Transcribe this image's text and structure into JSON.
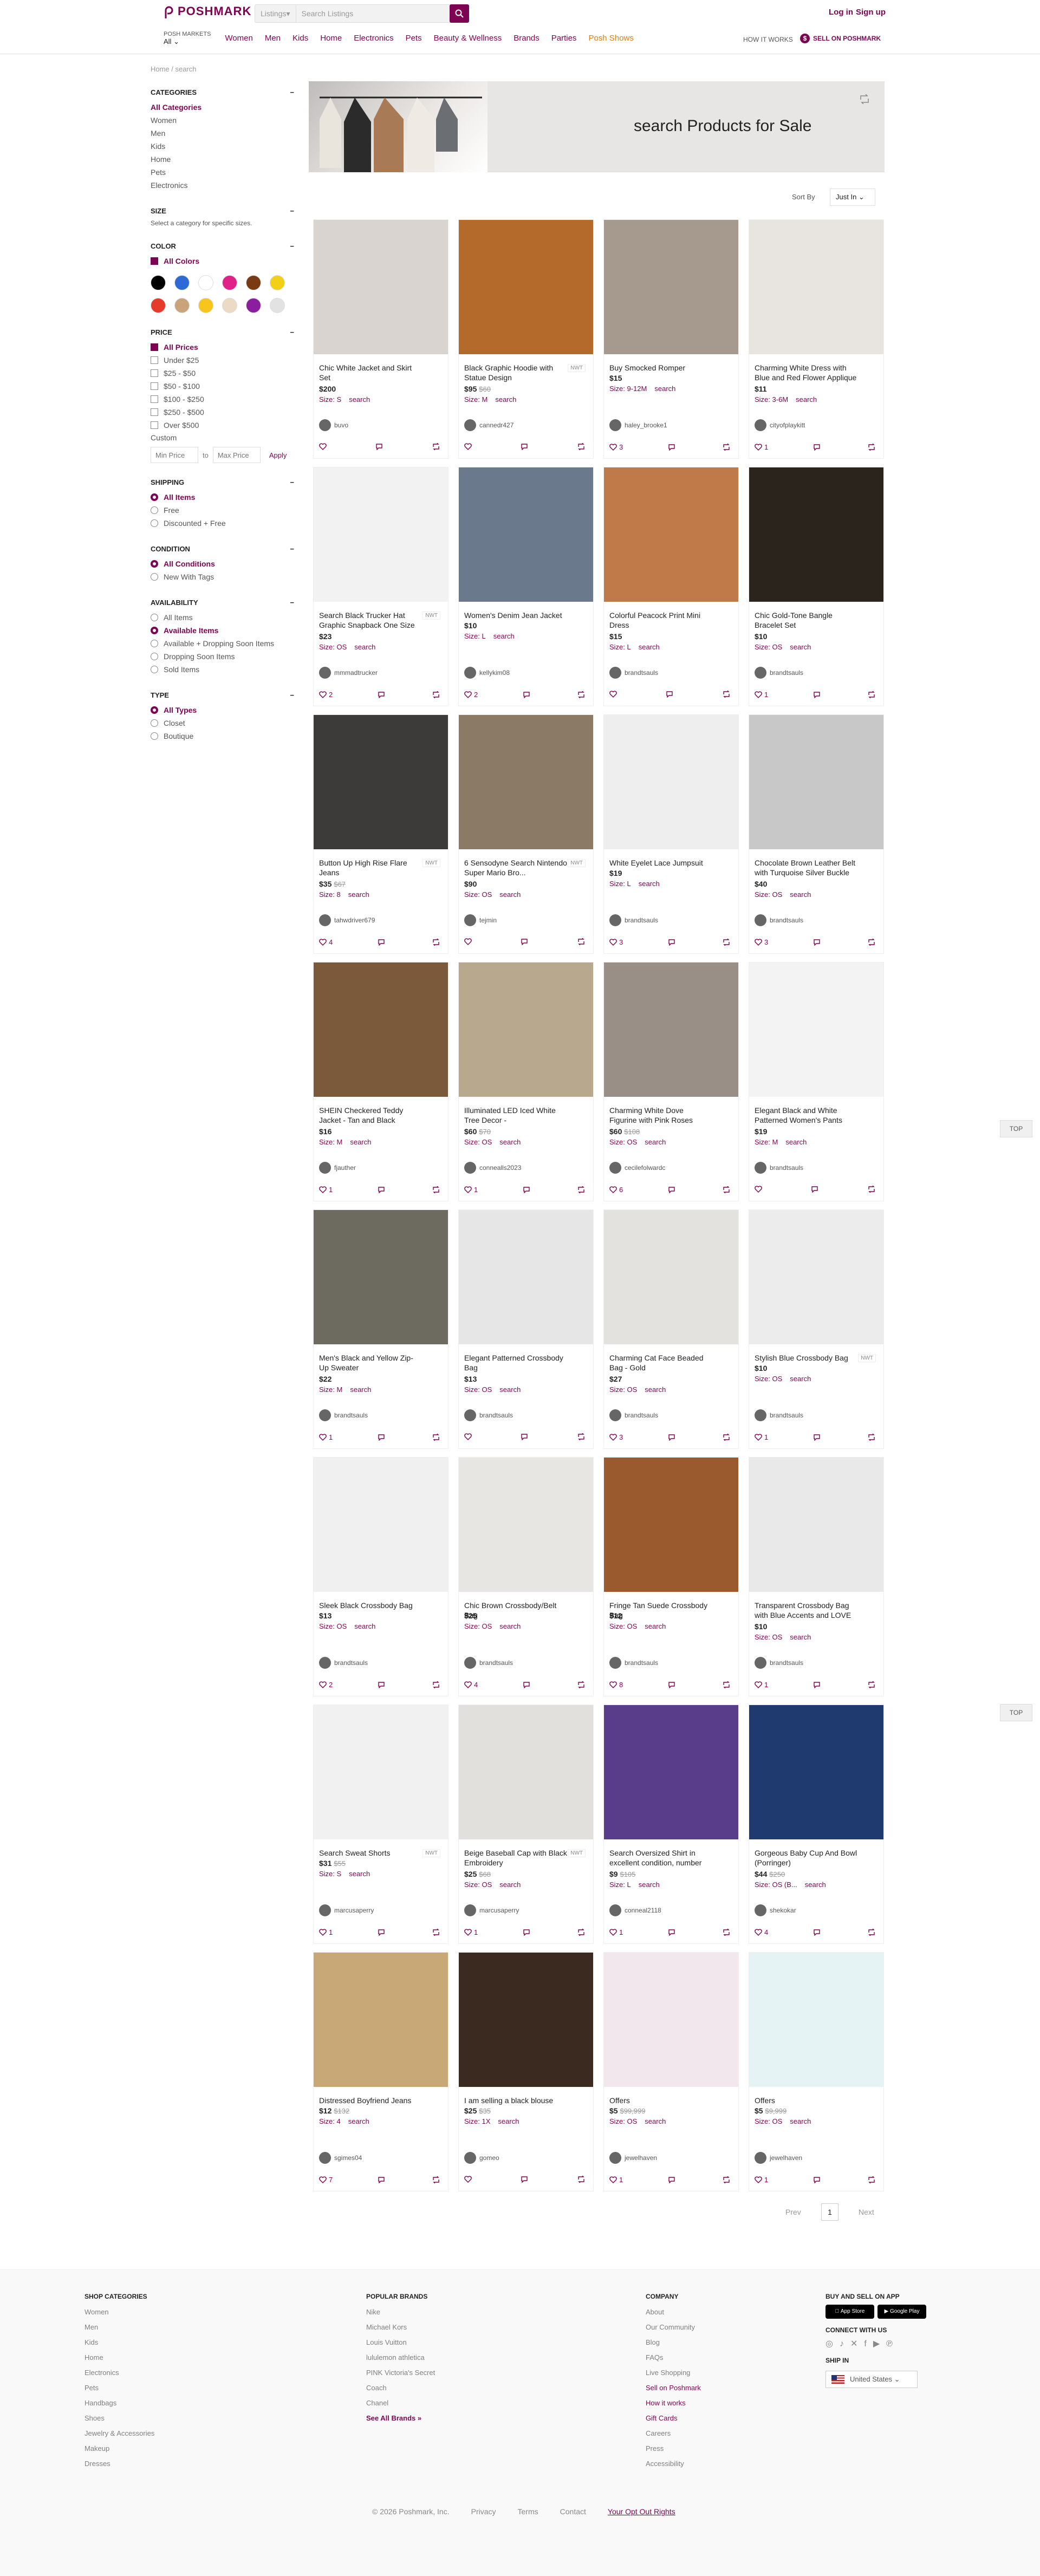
{
  "header": {
    "logo": "POSHMARK",
    "search_scope": "Listings",
    "search_placeholder": "Search Listings",
    "login": "Log in",
    "signup": "Sign up",
    "market_label": "POSH MARKETS",
    "market_value": "All",
    "nav": [
      "Women",
      "Men",
      "Kids",
      "Home",
      "Electronics",
      "Pets",
      "Beauty & Wellness",
      "Brands",
      "Parties",
      "Posh Shows"
    ],
    "how_it_works": "HOW IT WORKS",
    "sell": "SELL ON POSHMARK"
  },
  "sidebar": {
    "breadcrumb": "Home  /  search",
    "categories": {
      "title": "CATEGORIES",
      "items": [
        "All Categories",
        "Women",
        "Men",
        "Kids",
        "Home",
        "Pets",
        "Electronics"
      ]
    },
    "size": {
      "title": "SIZE",
      "note": "Select a category for specific sizes."
    },
    "color": {
      "title": "COLOR",
      "all": "All Colors",
      "swatches": [
        "#000000",
        "#2d6ad6",
        "#ffffff",
        "#e0218a",
        "#7a3b12",
        "#f2d017",
        "#e53b2c",
        "#c9a37a",
        "#f7c51b",
        "#ecd9c6",
        "#8a1e9e",
        "#e2e2e2"
      ]
    },
    "price": {
      "title": "PRICE",
      "items": [
        "All Prices",
        "Under $25",
        "$25 - $50",
        "$50 - $100",
        "$100 - $250",
        "$250 - $500",
        "Over $500"
      ],
      "custom": "Custom",
      "min": "Min Price",
      "to": "to",
      "max": "Max Price",
      "apply": "Apply"
    },
    "shipping": {
      "title": "SHIPPING",
      "items": [
        "All Items",
        "Free",
        "Discounted + Free"
      ]
    },
    "condition": {
      "title": "CONDITION",
      "items": [
        "All Conditions",
        "New With Tags"
      ]
    },
    "availability": {
      "title": "AVAILABILITY",
      "items": [
        "All Items",
        "Available Items",
        "Available + Dropping Soon Items",
        "Dropping Soon Items",
        "Sold Items"
      ]
    },
    "type": {
      "title": "TYPE",
      "items": [
        "All Types",
        "Closet",
        "Boutique"
      ]
    }
  },
  "banner": {
    "title": "search Products for Sale"
  },
  "sort": {
    "label": "Sort By",
    "value": "Just In"
  },
  "products": [
    {
      "title": "Chic White Jacket and Skirt Set",
      "price": "$200",
      "orig": "",
      "size": "Size: S",
      "tag": "search",
      "user": "buvo",
      "likes": "",
      "nwt": "",
      "img": "#d9d4cf"
    },
    {
      "title": "Black Graphic Hoodie with Statue Design",
      "price": "$95",
      "orig": "$60",
      "size": "Size: M",
      "tag": "search",
      "user": "cannedr427",
      "likes": "",
      "nwt": "NWT",
      "img": "#b36a2a"
    },
    {
      "title": "Buy Smocked Romper",
      "price": "$15",
      "orig": "",
      "size": "Size: 9-12M",
      "tag": "search",
      "user": "haley_brooke1",
      "likes": "3",
      "nwt": "",
      "img": "#a59a8d"
    },
    {
      "title": "Charming White Dress with Blue and Red Flower Applique",
      "price": "$11",
      "orig": "",
      "size": "Size: 3-6M",
      "tag": "search",
      "user": "cityofplaykitt",
      "likes": "1",
      "nwt": "",
      "img": "#e8e4df"
    },
    {
      "title": "Search Black Trucker Hat Graphic Snapback One Size",
      "price": "$23",
      "orig": "",
      "size": "Size: OS",
      "tag": "search",
      "user": "mmmadtrucker",
      "likes": "2",
      "nwt": "NWT",
      "img": "#f2f2f2"
    },
    {
      "title": "Women's Denim Jean Jacket",
      "price": "$10",
      "orig": "",
      "size": "Size: L",
      "tag": "search",
      "user": "kellykim08",
      "likes": "2",
      "nwt": "",
      "img": "#6a7a8c"
    },
    {
      "title": "Colorful Peacock Print Mini Dress",
      "price": "$15",
      "orig": "",
      "size": "Size: L",
      "tag": "search",
      "user": "brandtsauls",
      "likes": "",
      "nwt": "",
      "img": "#c07a4a"
    },
    {
      "title": "Chic Gold-Tone Bangle Bracelet Set",
      "price": "$10",
      "orig": "",
      "size": "Size: OS",
      "tag": "search",
      "user": "brandtsauls",
      "likes": "1",
      "nwt": "",
      "img": "#2a241c"
    },
    {
      "title": "Button Up High Rise Flare Jeans",
      "price": "$35",
      "orig": "$67",
      "size": "Size: 8",
      "tag": "search",
      "user": "tahwdriver679",
      "likes": "4",
      "nwt": "NWT",
      "img": "#3d3b3a"
    },
    {
      "title": "6 Sensodyne Search Nintendo Super Mario Bro...",
      "price": "$90",
      "orig": "",
      "size": "Size: OS",
      "tag": "search",
      "user": "tejmin",
      "likes": "",
      "nwt": "NWT",
      "img": "#8a7a66"
    },
    {
      "title": "White Eyelet Lace Jumpsuit",
      "price": "$19",
      "orig": "",
      "size": "Size: L",
      "tag": "search",
      "user": "brandtsauls",
      "likes": "3",
      "nwt": "",
      "img": "#eeeeee"
    },
    {
      "title": "Chocolate Brown Leather Belt with Turquoise Silver Buckle",
      "price": "$40",
      "orig": "",
      "size": "Size: OS",
      "tag": "search",
      "user": "brandtsauls",
      "likes": "3",
      "nwt": "",
      "img": "#c8c8c8"
    },
    {
      "title": "SHEIN Checkered Teddy Jacket - Tan and Black",
      "price": "$16",
      "orig": "",
      "size": "Size: M",
      "tag": "search",
      "user": "fjauther",
      "likes": "1",
      "nwt": "",
      "img": "#7a5a3a"
    },
    {
      "title": "Illuminated LED Iced White Tree Decor -",
      "price": "$60",
      "orig": "$70",
      "size": "Size: OS",
      "tag": "search",
      "user": "connealls2023",
      "likes": "1",
      "nwt": "",
      "img": "#b8a88e"
    },
    {
      "title": "Charming White Dove Figurine with Pink Roses",
      "price": "$60",
      "orig": "$108",
      "size": "Size: OS",
      "tag": "search",
      "user": "cecilefolwardc",
      "likes": "6",
      "nwt": "",
      "img": "#9a8f86"
    },
    {
      "title": "Elegant Black and White Patterned Women's Pants",
      "price": "$19",
      "orig": "",
      "size": "Size: M",
      "tag": "search",
      "user": "brandtsauls",
      "likes": "",
      "nwt": "",
      "img": "#f3f3f3"
    },
    {
      "title": "Men's Black and Yellow Zip-Up Sweater",
      "price": "$22",
      "orig": "",
      "size": "Size: M",
      "tag": "search",
      "user": "brandtsauls",
      "likes": "1",
      "nwt": "",
      "img": "#6d6a60"
    },
    {
      "title": "Elegant Patterned Crossbody Bag",
      "price": "$13",
      "orig": "",
      "size": "Size: OS",
      "tag": "search",
      "user": "brandtsauls",
      "likes": "",
      "nwt": "",
      "img": "#e6e6e6"
    },
    {
      "title": "Charming Cat Face Beaded Bag - Gold",
      "price": "$27",
      "orig": "",
      "size": "Size: OS",
      "tag": "search",
      "user": "brandtsauls",
      "likes": "3",
      "nwt": "",
      "img": "#e4e2de"
    },
    {
      "title": "Stylish Blue Crossbody Bag",
      "price": "$10",
      "orig": "",
      "size": "Size: OS",
      "tag": "search",
      "user": "brandtsauls",
      "likes": "1",
      "nwt": "NWT",
      "img": "#ececec"
    },
    {
      "title": "Sleek Black Crossbody Bag",
      "price": "$13",
      "orig": "",
      "size": "Size: OS",
      "tag": "search",
      "user": "brandtsauls",
      "likes": "2",
      "nwt": "",
      "img": "#f0f0f0"
    },
    {
      "title": "Chic Brown Crossbody/Belt Bag",
      "price": "$25",
      "orig": "",
      "size": "Size: OS",
      "tag": "search",
      "user": "brandtsauls",
      "likes": "4",
      "nwt": "",
      "img": "#e8e6e3"
    },
    {
      "title": "Fringe Tan Suede Crossbody Bag",
      "price": "$12",
      "orig": "",
      "size": "Size: OS",
      "tag": "search",
      "user": "brandtsauls",
      "likes": "8",
      "nwt": "",
      "img": "#9a5a2e"
    },
    {
      "title": "Transparent Crossbody Bag with Blue Accents and LOVE Strap",
      "price": "$10",
      "orig": "",
      "size": "Size: OS",
      "tag": "search",
      "user": "brandtsauls",
      "likes": "1",
      "nwt": "",
      "img": "#e9e9ea"
    },
    {
      "title": "Search Sweat Shorts",
      "price": "$31",
      "orig": "$55",
      "size": "Size: S",
      "tag": "search",
      "user": "marcusaperry",
      "likes": "1",
      "nwt": "NWT",
      "img": "#f1f1f1"
    },
    {
      "title": "Beige Baseball Cap with Black Embroidery",
      "price": "$25",
      "orig": "$68",
      "size": "Size: OS",
      "tag": "search",
      "user": "marcusaperry",
      "likes": "1",
      "nwt": "NWT",
      "img": "#e2e0dc"
    },
    {
      "title": "Search Oversized Shirt in excellent condition, number print on the...",
      "price": "$9",
      "orig": "$105",
      "size": "Size: L",
      "tag": "search",
      "user": "conneal2118",
      "likes": "1",
      "nwt": "",
      "img": "#5a3d8a"
    },
    {
      "title": "Gorgeous Baby Cup And Bowl (Porringer)",
      "price": "$44",
      "orig": "$250",
      "size": "Size: OS (B...",
      "tag": "search",
      "user": "shekokar",
      "likes": "4",
      "nwt": "",
      "img": "#1f3a6e"
    },
    {
      "title": "Distressed Boyfriend Jeans",
      "price": "$12",
      "orig": "$132",
      "size": "Size: 4",
      "tag": "search",
      "user": "sgimes04",
      "likes": "7",
      "nwt": "",
      "img": "#c8a876"
    },
    {
      "title": "I am selling a black blouse",
      "price": "$25",
      "orig": "$35",
      "size": "Size: 1X",
      "tag": "search",
      "user": "gomeo",
      "likes": "",
      "nwt": "",
      "img": "#3a2a20"
    },
    {
      "title": "Offers",
      "price": "$5",
      "orig": "$99,999",
      "size": "Size: OS",
      "tag": "search",
      "user": "jewelhaven",
      "likes": "1",
      "nwt": "",
      "img": "#f3e7ee"
    },
    {
      "title": "Offers",
      "price": "$5",
      "orig": "$9,999",
      "size": "Size: OS",
      "tag": "search",
      "user": "jewelhaven",
      "likes": "1",
      "nwt": "",
      "img": "#e6f3f5"
    }
  ],
  "pagination": {
    "prev": "Prev",
    "page": "1",
    "next": "Next"
  },
  "top": "TOP",
  "footer": {
    "shop": {
      "title": "SHOP CATEGORIES",
      "items": [
        "Women",
        "Men",
        "Kids",
        "Home",
        "Electronics",
        "Pets",
        "Handbags",
        "Shoes",
        "Jewelry & Accessories",
        "Makeup",
        "Dresses"
      ]
    },
    "brands": {
      "title": "POPULAR BRANDS",
      "items": [
        "Nike",
        "Michael Kors",
        "Louis Vuitton",
        "lululemon athletica",
        "PINK Victoria's Secret",
        "Coach",
        "Chanel"
      ],
      "all": "See All Brands »"
    },
    "company": {
      "title": "COMPANY",
      "items": [
        "About",
        "Our Community",
        "Blog",
        "FAQs",
        "Live Shopping",
        "Sell on Poshmark",
        "How it works",
        "Gift Cards",
        "Careers",
        "Press",
        "Accessibility"
      ]
    },
    "app": {
      "title": "BUY AND SELL ON APP",
      "appstore": "App Store",
      "googleplay": "Google Play",
      "connect": "CONNECT WITH US",
      "shipin": "SHIP IN",
      "country": "United States"
    },
    "bottom": [
      "© 2026 Poshmark, Inc.",
      "Privacy",
      "Terms",
      "Contact",
      "Your Opt Out Rights"
    ]
  }
}
